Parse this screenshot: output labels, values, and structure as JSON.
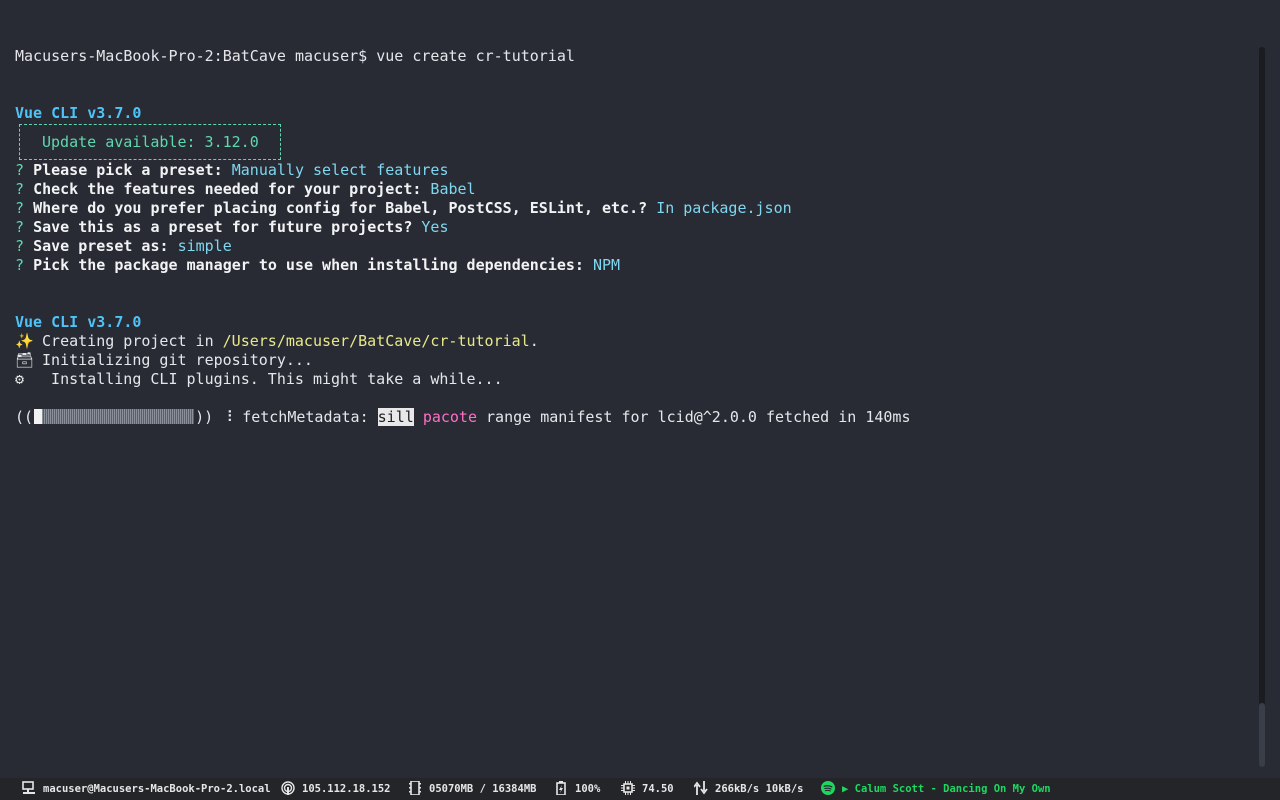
{
  "terminal": {
    "prompt_line": "Macusers-MacBook-Pro-2:BatCave macuser$ vue create cr-tutorial",
    "vue_cli_version": "Vue CLI v3.7.0",
    "update_notice": "Update available: 3.12.0",
    "question_mark": "?",
    "questions": [
      {
        "question": "Please pick a preset:",
        "answer": "Manually select features"
      },
      {
        "question": "Check the features needed for your project:",
        "answer": "Babel"
      },
      {
        "question": "Where do you prefer placing config for Babel, PostCSS, ESLint, etc.?",
        "answer": "In package.json"
      },
      {
        "question": "Save this as a preset for future projects?",
        "answer": "Yes"
      },
      {
        "question": "Save preset as:",
        "answer": "simple"
      },
      {
        "question": "Pick the package manager to use when installing dependencies:",
        "answer": "NPM"
      }
    ],
    "vue_cli_version_2": "Vue CLI v3.7.0",
    "creating": {
      "icon": "✨",
      "prefix": " Creating project in ",
      "path": "/Users/macuser/BatCave/cr-tutorial",
      "suffix": "."
    },
    "initializing": {
      "icon": "🗃",
      "text": " Initializing git repository..."
    },
    "installing": {
      "icon": "⚙",
      "text": "  Installing CLI plugins. This might take a while..."
    },
    "progress": {
      "open": "((",
      "close": "))",
      "fraction": 0.05,
      "separator": " ⠸ ",
      "task": "fetchMetadata: ",
      "level": "sill",
      "module": "pacote",
      "message": " range manifest for lcid@^2.0.0 fetched in 140ms"
    }
  },
  "statusbar": {
    "host": "macuser@Macusers-MacBook-Pro-2.local",
    "ip": "105.112.18.152",
    "memory": "05070MB / 16384MB",
    "battery": "100%",
    "cpu": "74.50",
    "network": "266kB/s 10kB/s",
    "music": "▶ Calum Scott - Dancing On My Own"
  },
  "colors": {
    "background": "#282b33",
    "accent_vue": "#4fc3f7",
    "prompt_green": "#5fd7af",
    "answer_cyan": "#7fd7f0",
    "path_yellow": "#e8e88a",
    "pink": "#ff6ec7",
    "spotify_green": "#1ed760"
  },
  "icons": {
    "host": "computer-icon",
    "ip": "wifi-signal-icon",
    "memory": "memory-icon",
    "battery": "battery-icon",
    "cpu": "cpu-icon",
    "network": "network-arrows-icon",
    "music": "spotify-icon"
  }
}
